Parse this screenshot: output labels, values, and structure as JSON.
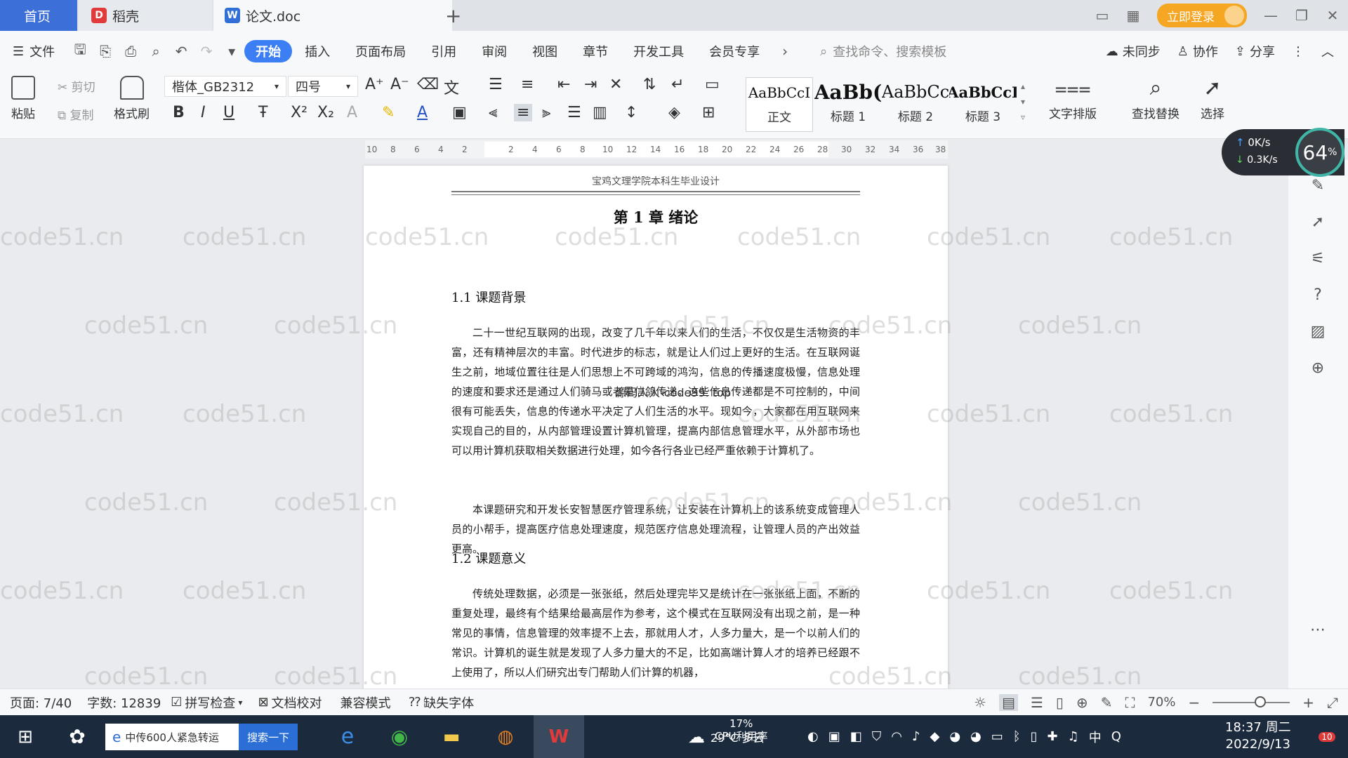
{
  "tabs": {
    "home": "首页",
    "daoke": "稻壳",
    "doc": "论文.doc"
  },
  "titlebar": {
    "login": "立即登录"
  },
  "menu": {
    "file": "文件",
    "items": [
      "开始",
      "插入",
      "页面布局",
      "引用",
      "审阅",
      "视图",
      "章节",
      "开发工具",
      "会员专享"
    ],
    "search_cmd": "查找命令、搜索模板",
    "sync": "未同步",
    "collab": "协作",
    "share": "分享"
  },
  "ribbon": {
    "paste": "粘贴",
    "cut": "剪切",
    "copy": "复制",
    "format_painter": "格式刷",
    "font_name": "楷体_GB2312",
    "font_size": "四号",
    "styles": [
      {
        "preview": "AaBbCcI",
        "name": "正文"
      },
      {
        "preview": "AaBb(",
        "name": "标题 1"
      },
      {
        "preview": "AaBbCc",
        "name": "标题 2"
      },
      {
        "preview": "AaBbCcI",
        "name": "标题 3"
      }
    ],
    "text_layout": "文字排版",
    "find_replace": "查找替换",
    "select": "选择"
  },
  "ruler": {
    "ticks": [
      "10",
      "8",
      "6",
      "4",
      "2",
      "2",
      "4",
      "6",
      "8",
      "10",
      "12",
      "14",
      "16",
      "18",
      "20",
      "22",
      "24",
      "26",
      "28",
      "30",
      "32",
      "34",
      "36",
      "38"
    ]
  },
  "document": {
    "header": "宝鸡文理学院本科生毕业设计",
    "chapter": "第 1 章  绪论",
    "sec1": "1.1  课题背景",
    "p1": "二十一世纪互联网的出现，改变了几千年以来人们的生活，不仅仅是生活物资的丰富，还有精神层次的丰富。时代进步的标志，就是让人们过上更好的生活。在互联网诞生之前，地域位置往往是人们思想上不可跨域的鸿沟，信息的传播速度极慢，信息处理的速度和要求还是通过人们骑马或者是信鸽传递，这些信息传递都是不可控制的，中间很有可能丢失，信息的传递水平决定了人们生活的水平。现如今，大家都在用互联网来实现自己的目的，从内部管理设置计算机管理，提高内部信息管理水平，从外部市场也可以用计算机获取相关数据进行处理，如今各行各业已经严重依赖于计算机了。",
    "p2": "本课题研究和开发长安智慧医疗管理系统，让安装在计算机上的该系统变成管理人员的小帮手，提高医疗信息处理速度，规范医疗信息处理流程，让管理人员的产出效益更高。",
    "sec2": "1.2  课题意义",
    "p3": "传统处理数据，必须是一张张纸，然后处理完毕又是统计在一张张纸上面，不断的重复处理，最终有个结果给最高层作为参考，这个模式在互联网没有出现之前，是一种常见的事情，信息管理的效率提不上去，那就用人才，人多力量大，是一个以前人们的常识。计算机的诞生就是发现了人多力量大的不足，比如高端计算人才的培养已经跟不上使用了，所以人们研究出专门帮助人们计算的机器，",
    "overlay": "源码人人-code99. top",
    "watermark": "code51.cn"
  },
  "speed_widget": {
    "up": "0K/s",
    "down": "0.3K/s",
    "percent": "64",
    "percent_unit": "%"
  },
  "statusbar": {
    "page": "页面: 7/40",
    "words": "字数: 12839",
    "spell": "拼写检查",
    "proof": "文档校对",
    "compat": "兼容模式",
    "missing_font": "缺失字体",
    "zoom": "70%"
  },
  "taskbar": {
    "search_text": "中传600人紧急转运",
    "search_btn": "搜索一下",
    "weather": "29°C 多云",
    "cpu": "17%",
    "cpu_label": "CPU利用率",
    "ime": "中",
    "time": "18:37 周二",
    "date": "2022/9/13",
    "notif": "10"
  }
}
